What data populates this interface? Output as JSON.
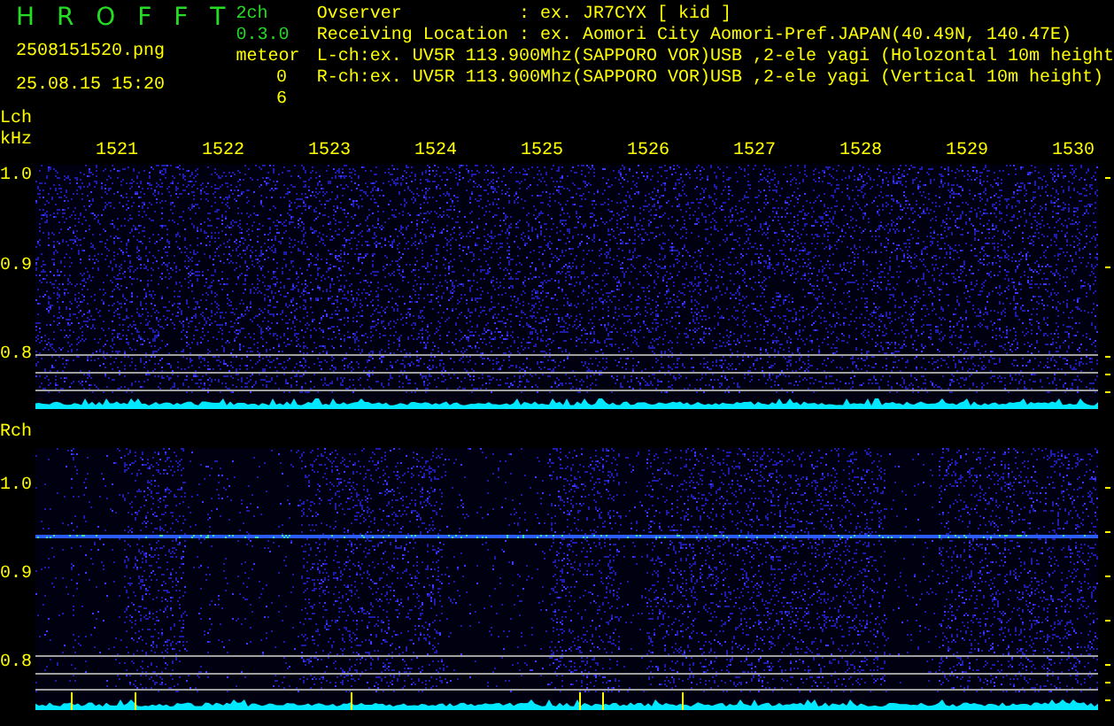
{
  "header": {
    "title": "H R O F F T",
    "version": "2ch 0.3.0",
    "filename": "2508151520.png",
    "timestamp": "25.08.15 15:20",
    "meteor_label": "meteor",
    "meteor_counts": [
      "0",
      "6"
    ],
    "info_lines": [
      "Ovserver           : ex. JR7CYX [ kid ]",
      "Receiving Location : ex. Aomori City Aomori-Pref.JAPAN(40.49N, 140.47E)",
      "L-ch:ex. UV5R 113.900Mhz(SAPPORO VOR)USB ,2-ele yagi (Holozontal 10m height",
      "R-ch:ex. UV5R 113.900Mhz(SAPPORO VOR)USB ,2-ele yagi (Vertical 10m height)"
    ]
  },
  "channels": [
    {
      "label": "Lch",
      "unit": "kHz",
      "time_labels": [
        "1521",
        "1522",
        "1523",
        "1524",
        "1525",
        "1526",
        "1527",
        "1528",
        "1529",
        "1530"
      ],
      "y_labels": [
        "1.0",
        "0.9",
        "0.8"
      ]
    },
    {
      "label": "Rch",
      "y_labels": [
        "1.0",
        "0.9",
        "0.8"
      ]
    }
  ]
}
